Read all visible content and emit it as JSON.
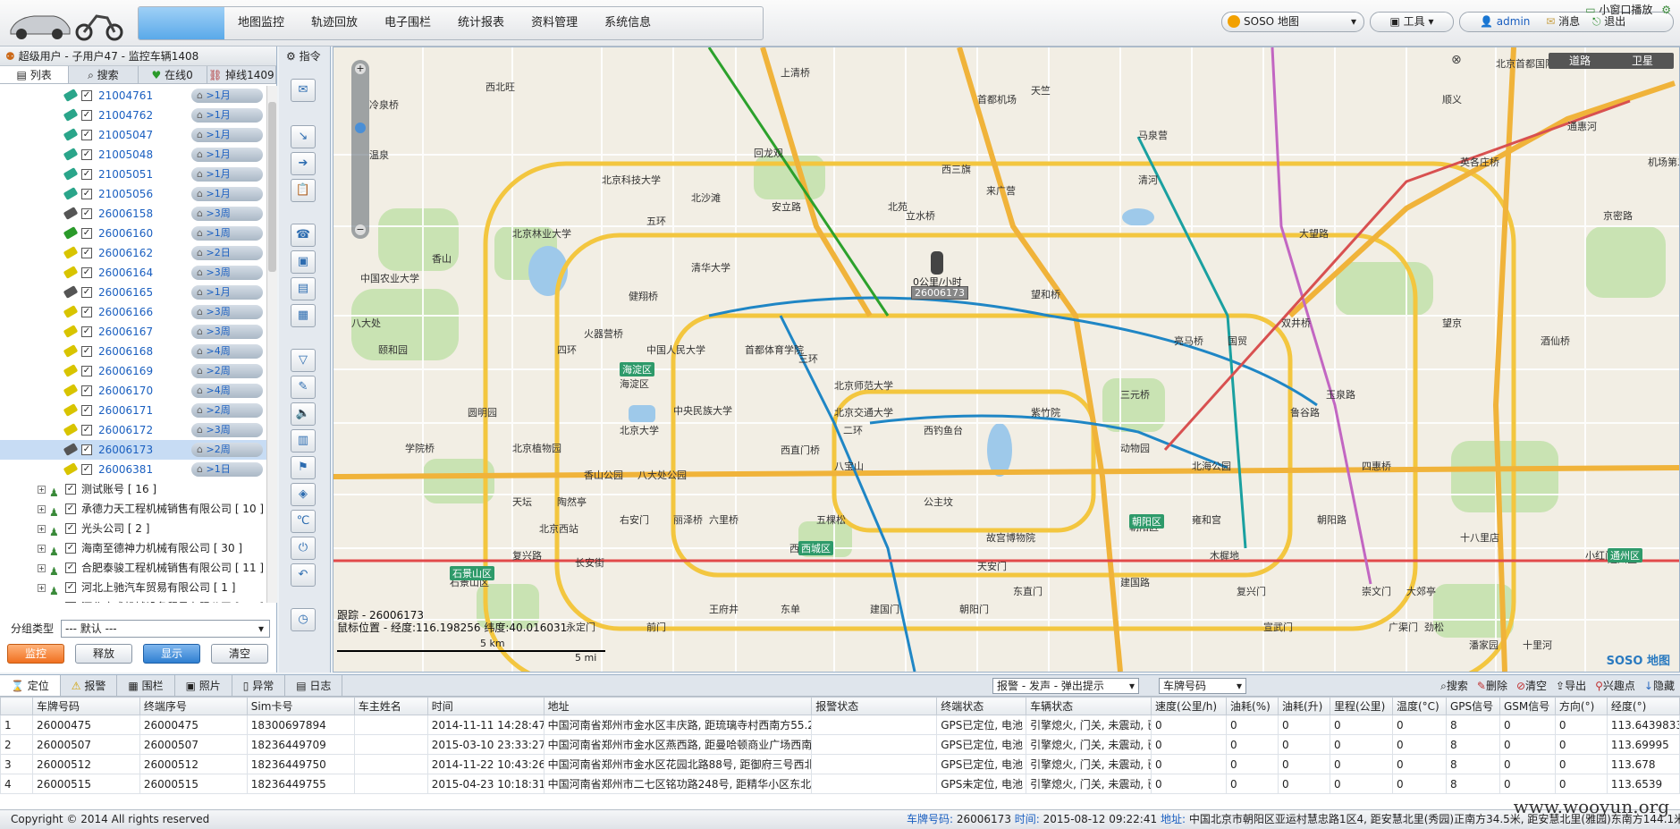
{
  "nav": {
    "items": [
      "地图监控",
      "轨迹回放",
      "电子围栏",
      "统计报表",
      "资料管理",
      "系统信息"
    ]
  },
  "top": {
    "map_select": "SOSO 地图",
    "tools": "工具",
    "user": "admin",
    "msg": "消息",
    "logout": "退出",
    "mini": "小窗口播放"
  },
  "left": {
    "user_info": "超级用户 - 子用户47 - 监控车辆1408",
    "tabs": [
      "列表",
      "搜索",
      "在线0",
      "掉线1409"
    ],
    "vehicles": [
      {
        "id": "21004761",
        "status": ">1月"
      },
      {
        "id": "21004762",
        "status": ">1月"
      },
      {
        "id": "21005047",
        "status": ">1月"
      },
      {
        "id": "21005048",
        "status": ">1月"
      },
      {
        "id": "21005051",
        "status": ">1月"
      },
      {
        "id": "21005056",
        "status": ">1月"
      },
      {
        "id": "26006158",
        "status": ">3周"
      },
      {
        "id": "26006160",
        "status": ">1周"
      },
      {
        "id": "26006162",
        "status": ">2日"
      },
      {
        "id": "26006164",
        "status": ">3周"
      },
      {
        "id": "26006165",
        "status": ">1月"
      },
      {
        "id": "26006166",
        "status": ">3周"
      },
      {
        "id": "26006167",
        "status": ">3周"
      },
      {
        "id": "26006168",
        "status": ">4周"
      },
      {
        "id": "26006169",
        "status": ">2周"
      },
      {
        "id": "26006170",
        "status": ">4周"
      },
      {
        "id": "26006171",
        "status": ">2周"
      },
      {
        "id": "26006172",
        "status": ">3周"
      },
      {
        "id": "26006173",
        "status": ">2周"
      },
      {
        "id": "26006381",
        "status": ">1日"
      }
    ],
    "groups": [
      "测试账号 [ 16 ]",
      "承德力天工程机械销售有限公司 [ 10 ]",
      "光头公司 [ 2 ]",
      "海南至德神力机械有限公司 [ 30 ]",
      "合肥泰骏工程机械销售有限公司 [ 11 ]",
      "河北上驰汽车贸易有限公司 [ 1 ]",
      "河北唐成机械设备贸易有限公司 [ 30 ]"
    ],
    "group_type_label": "分组类型",
    "group_type_value": "--- 默认 ---",
    "buttons": [
      "监控",
      "释放",
      "显示",
      "清空"
    ]
  },
  "cmd": {
    "title": "指令"
  },
  "map": {
    "types": [
      "道路",
      "卫星"
    ],
    "car_label": "26006173",
    "car_speed": "0公里/小时",
    "track_info": "跟踪 - 26006173",
    "coord": "鼠标位置 - 经度:116.198256 纬度:40.016031",
    "scale_km": "5 km",
    "scale_mi": "5 mi",
    "brand": "SOSO 地图",
    "labels": [
      "冷泉桥",
      "西北旺",
      "温泉",
      "香山",
      "八大处",
      "石景山区",
      "海淀区",
      "西城区",
      "朝阳区",
      "通州区",
      "北京首都国际机场三号航站楼",
      "望和桥",
      "火器营桥",
      "西直门桥",
      "天安门",
      "故宫博物院",
      "中国人民大学",
      "北京大学",
      "清华大学",
      "五环",
      "四环",
      "三环",
      "二环",
      "中央民族大学",
      "北京交通大学",
      "首都体育学院",
      "北京师范大学",
      "三元桥",
      "亮马桥",
      "国贸",
      "四惠桥",
      "朝阳路",
      "建国路",
      "复兴路",
      "长安街",
      "北京西站",
      "鲁谷路",
      "玉泉路",
      "双井桥",
      "大望路",
      "酒仙桥",
      "望京",
      "机场第二高速",
      "京密路",
      "通惠河",
      "顺义",
      "英各庄桥",
      "马泉营",
      "天竺",
      "首都机场",
      "来广营",
      "清河",
      "西三旗",
      "回龙观",
      "北苑",
      "立水桥",
      "上清桥",
      "健翔桥",
      "学院桥",
      "北沙滩",
      "安立路",
      "北京科技大学",
      "北京林业大学",
      "中国农业大学",
      "颐和园",
      "圆明园",
      "北京植物园",
      "香山公园",
      "八大处公园",
      "八宝山",
      "西钓鱼台",
      "紫竹院",
      "动物园",
      "北海公园",
      "雍和宫",
      "东直门",
      "朝阳门",
      "建国门",
      "东单",
      "王府井",
      "前门",
      "永定门",
      "天坛",
      "陶然亭",
      "右安门",
      "丽泽桥",
      "六里桥",
      "五棵松",
      "公主坟",
      "木樨地",
      "复兴门",
      "宣武门",
      "崇文门",
      "广渠门",
      "劲松",
      "潘家园",
      "十里河",
      "大郊亭",
      "十八里店",
      "小红门",
      "亦庄"
    ],
    "dist_labels": [
      "海淀区",
      "西城区",
      "朝阳区",
      "石景山区",
      "通州区"
    ]
  },
  "bottom": {
    "tabs": [
      "定位",
      "报警",
      "围栏",
      "照片",
      "异常",
      "日志"
    ],
    "alarm_select": "报警 - 发声 - 弹出提示",
    "plate_select": "车牌号码",
    "tools": [
      "搜索",
      "删除",
      "清空",
      "导出",
      "兴趣点",
      "隐藏"
    ],
    "columns": [
      "",
      "车牌号码",
      "终端序号",
      "Sim卡号",
      "车主姓名",
      "时间",
      "地址",
      "报警状态",
      "终端状态",
      "车辆状态",
      "速度(公里/h)",
      "油耗(%)",
      "油耗(升)",
      "里程(公里)",
      "温度(°C)",
      "GPS信号",
      "GSM信号",
      "方向(°)",
      "经度(°)"
    ],
    "rows": [
      [
        "1",
        "26000475",
        "26000475",
        "18300697894",
        "",
        "2014-11-11 14:28:47",
        "中国河南省郑州市金水区丰庆路, 距琉璃寺村西南方55.2",
        "",
        "GPS已定位, 电池",
        "引擎熄火, 门关, 未震动, 已",
        "0",
        "0",
        "0",
        "0",
        "0",
        "8",
        "0",
        "0",
        "113.6439833"
      ],
      [
        "2",
        "26000507",
        "26000507",
        "18236449709",
        "",
        "2015-03-10 23:33:27",
        "中国河南省郑州市金水区燕西路, 距曼哈顿商业广场西南",
        "",
        "GPS已定位, 电池",
        "引擎熄火, 门关, 未震动, 已",
        "0",
        "0",
        "0",
        "0",
        "0",
        "8",
        "0",
        "0",
        "113.69995"
      ],
      [
        "3",
        "26000512",
        "26000512",
        "18236449750",
        "",
        "2014-11-22 10:43:26",
        "中国河南省郑州市金水区花园北路88号, 距御府三号西北",
        "",
        "GPS已定位, 电池",
        "引擎熄火, 门关, 未震动, 已",
        "0",
        "0",
        "0",
        "0",
        "0",
        "8",
        "0",
        "0",
        "113.678"
      ],
      [
        "4",
        "26000515",
        "26000515",
        "18236449755",
        "",
        "2015-04-23 10:18:31",
        "中国河南省郑州市二七区铭功路248号, 距精华小区东北",
        "",
        "GPS未定位, 电池",
        "引擎熄火, 门关, 未震动, 已",
        "0",
        "0",
        "0",
        "0",
        "0",
        "8",
        "0",
        "0",
        "113.6539"
      ]
    ]
  },
  "status": {
    "copyright": "Copyright © 2014 All rights reserved",
    "plate_label": "车牌号码:",
    "plate": "26006173",
    "time_label": "时间:",
    "time": "2015-08-12 09:22:41",
    "addr_label": "地址:",
    "addr": "中国北京市朝阳区亚运村慧忠路1区4, 距安慧北里(秀园)正南方34.5米, 距安慧北里(雅园)东南方144.1米",
    "watermark": "www.wooyun.org"
  }
}
